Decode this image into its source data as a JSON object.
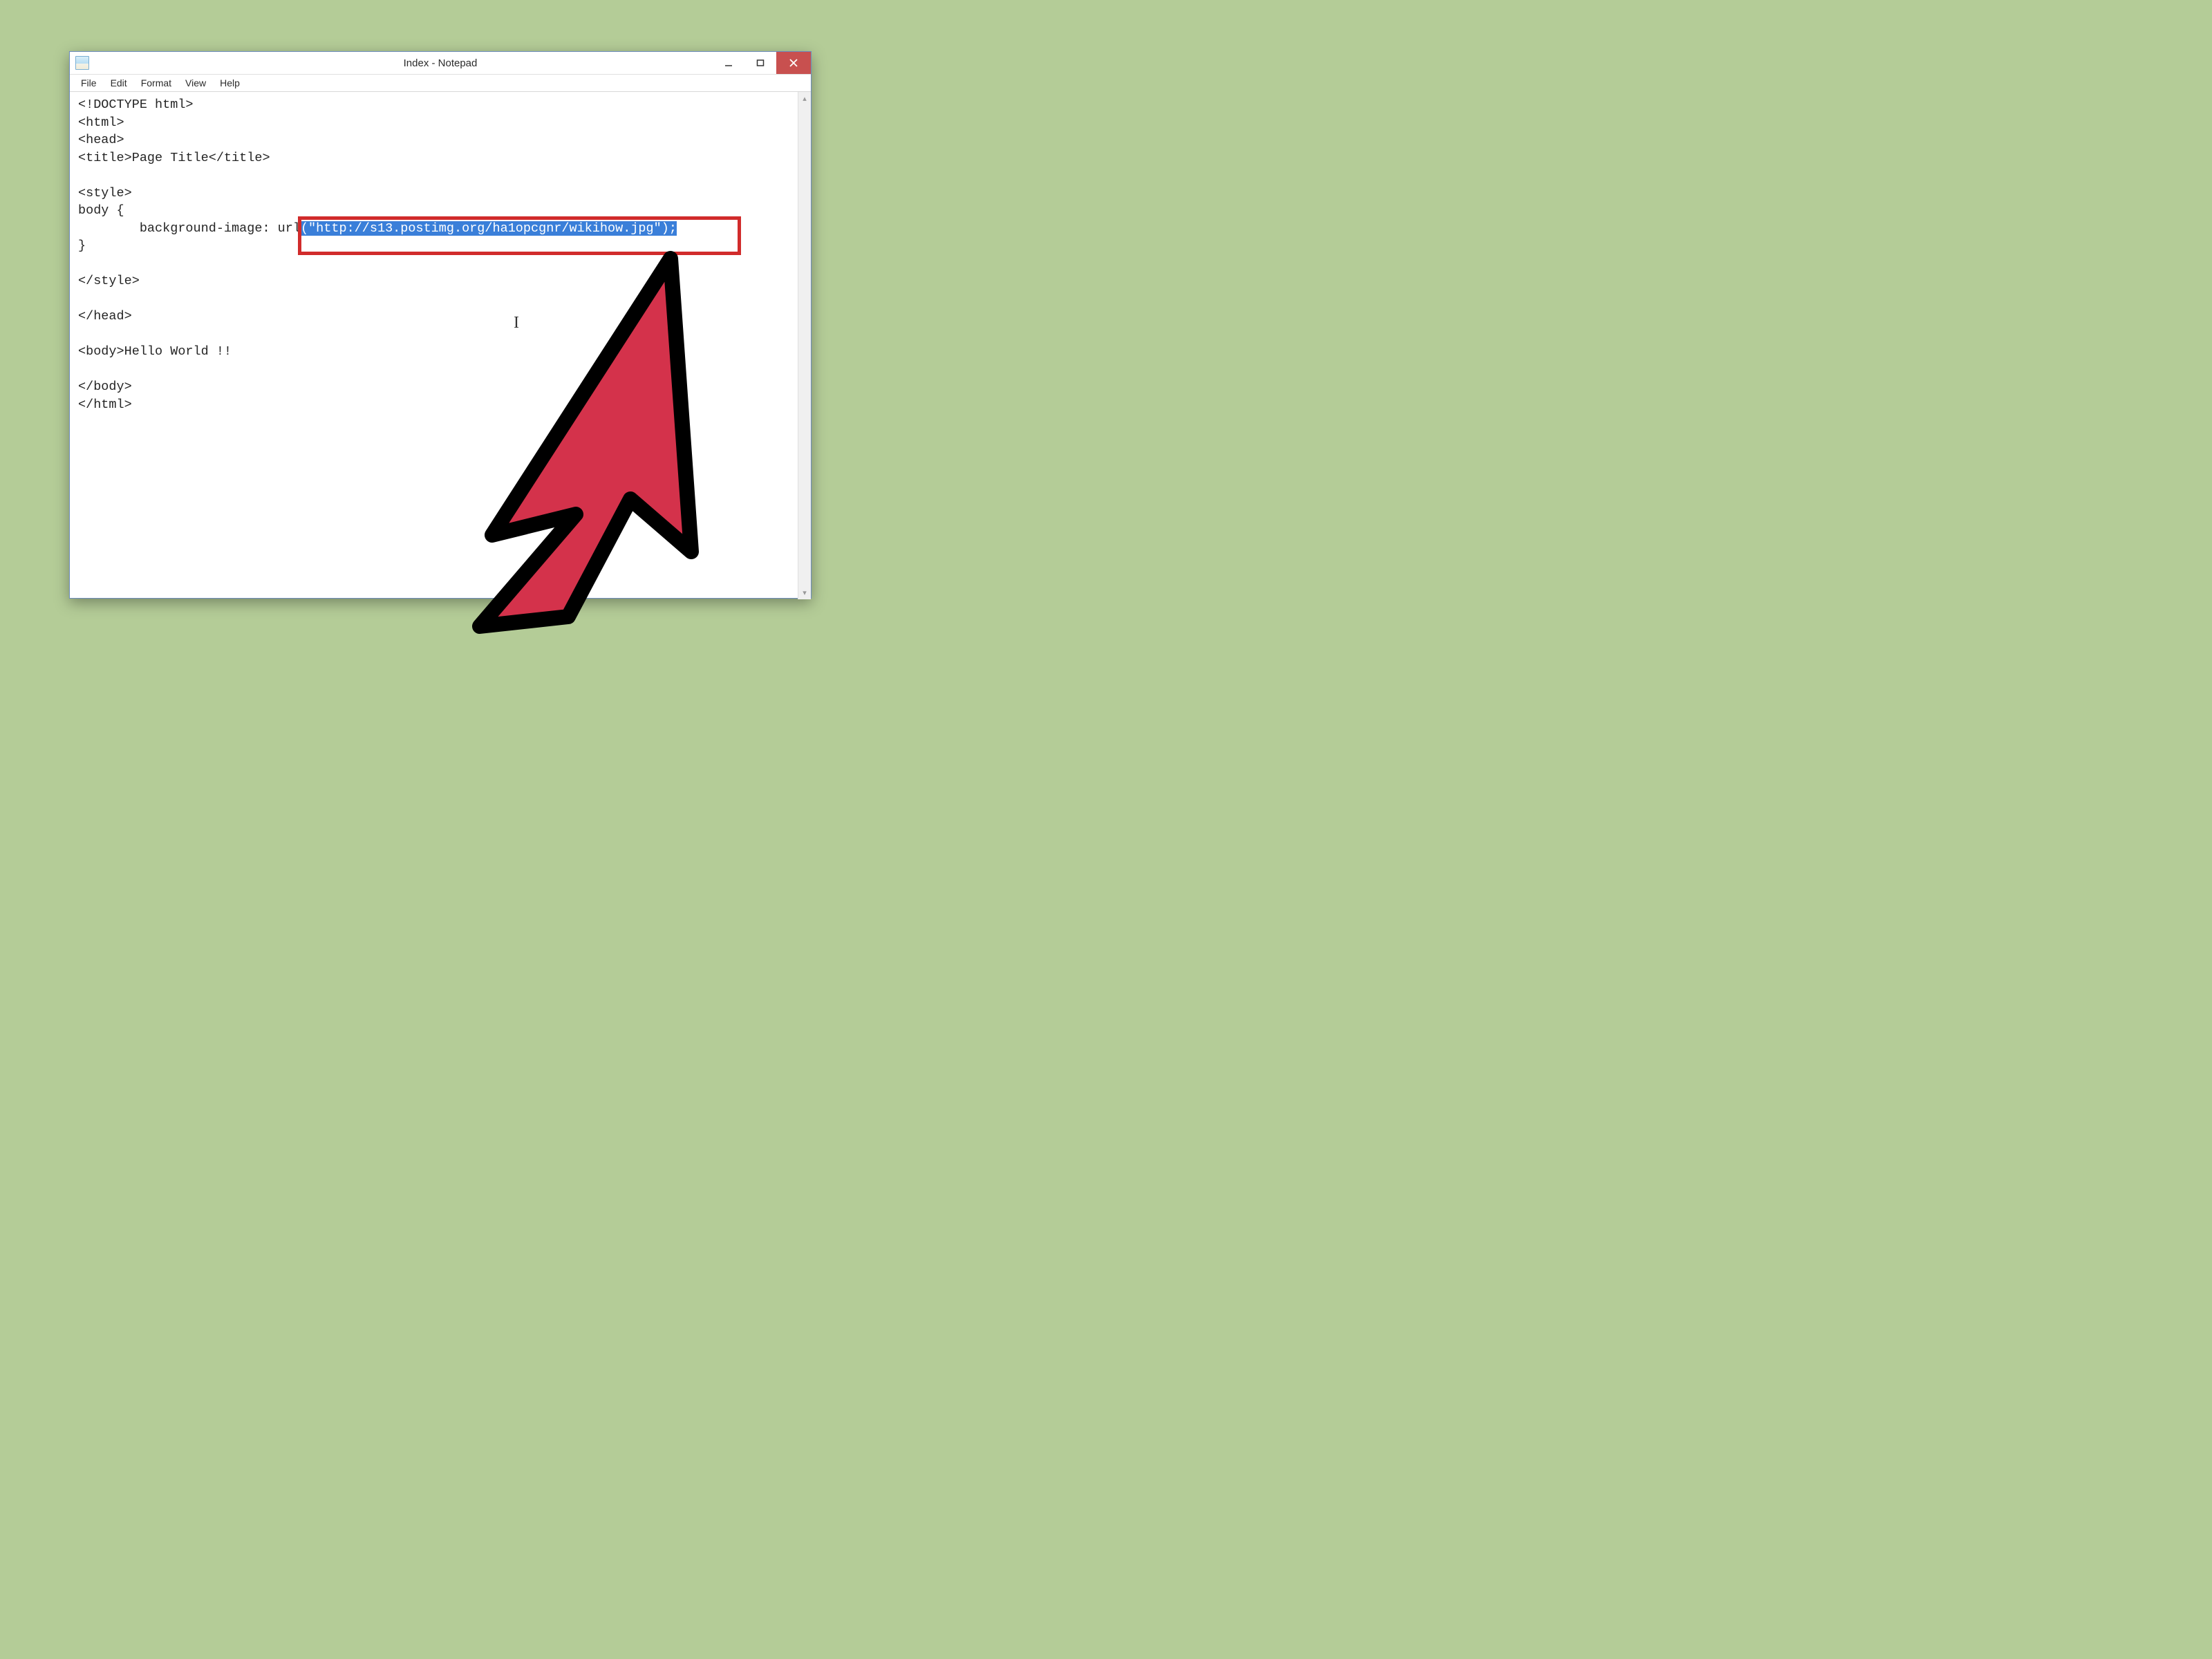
{
  "window": {
    "title": "Index - Notepad"
  },
  "menu": {
    "file": "File",
    "edit": "Edit",
    "format": "Format",
    "view": "View",
    "help": "Help"
  },
  "code": {
    "l1": "<!DOCTYPE html>",
    "l2": "<html>",
    "l3": "<head>",
    "l4": "<title>Page Title</title>",
    "l5": "",
    "l6": "<style>",
    "l7": "body {",
    "l8_pre": "        background-image: url",
    "l8_sel": "(\"http://s13.postimg.org/ha1opcgnr/wikihow.jpg\");",
    "l9": "}",
    "l10": "",
    "l11": "</style>",
    "l12": "",
    "l13": "</head>",
    "l14": "",
    "l15": "<body>Hello World !!",
    "l16": "",
    "l17": "</body>",
    "l18": "</html>"
  },
  "annotations": {
    "highlight_color": "#d12b2b",
    "selection_bg": "#3a7fd9",
    "arrow_color": "#d4324b"
  }
}
